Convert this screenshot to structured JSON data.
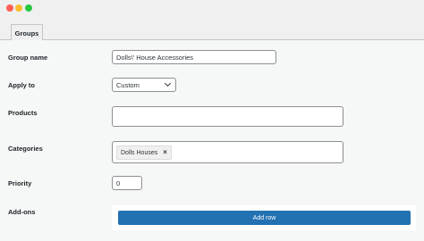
{
  "window": {
    "controls": [
      "close",
      "minimize",
      "maximize"
    ]
  },
  "tabs": [
    {
      "label": "Groups"
    }
  ],
  "form": {
    "group_name": {
      "label": "Group name",
      "value": "Dolls\\' House Accessories"
    },
    "apply_to": {
      "label": "Apply to",
      "value": "Custom"
    },
    "products": {
      "label": "Products",
      "value": ""
    },
    "categories": {
      "label": "Categories",
      "tags": [
        "Dolls Houses"
      ],
      "remove_glyph": "×"
    },
    "priority": {
      "label": "Priority",
      "value": "0"
    },
    "addons": {
      "label": "Add-ons",
      "add_row_label": "Add row"
    }
  },
  "colors": {
    "accent": "#2271b1",
    "background": "#f0f0f1"
  }
}
